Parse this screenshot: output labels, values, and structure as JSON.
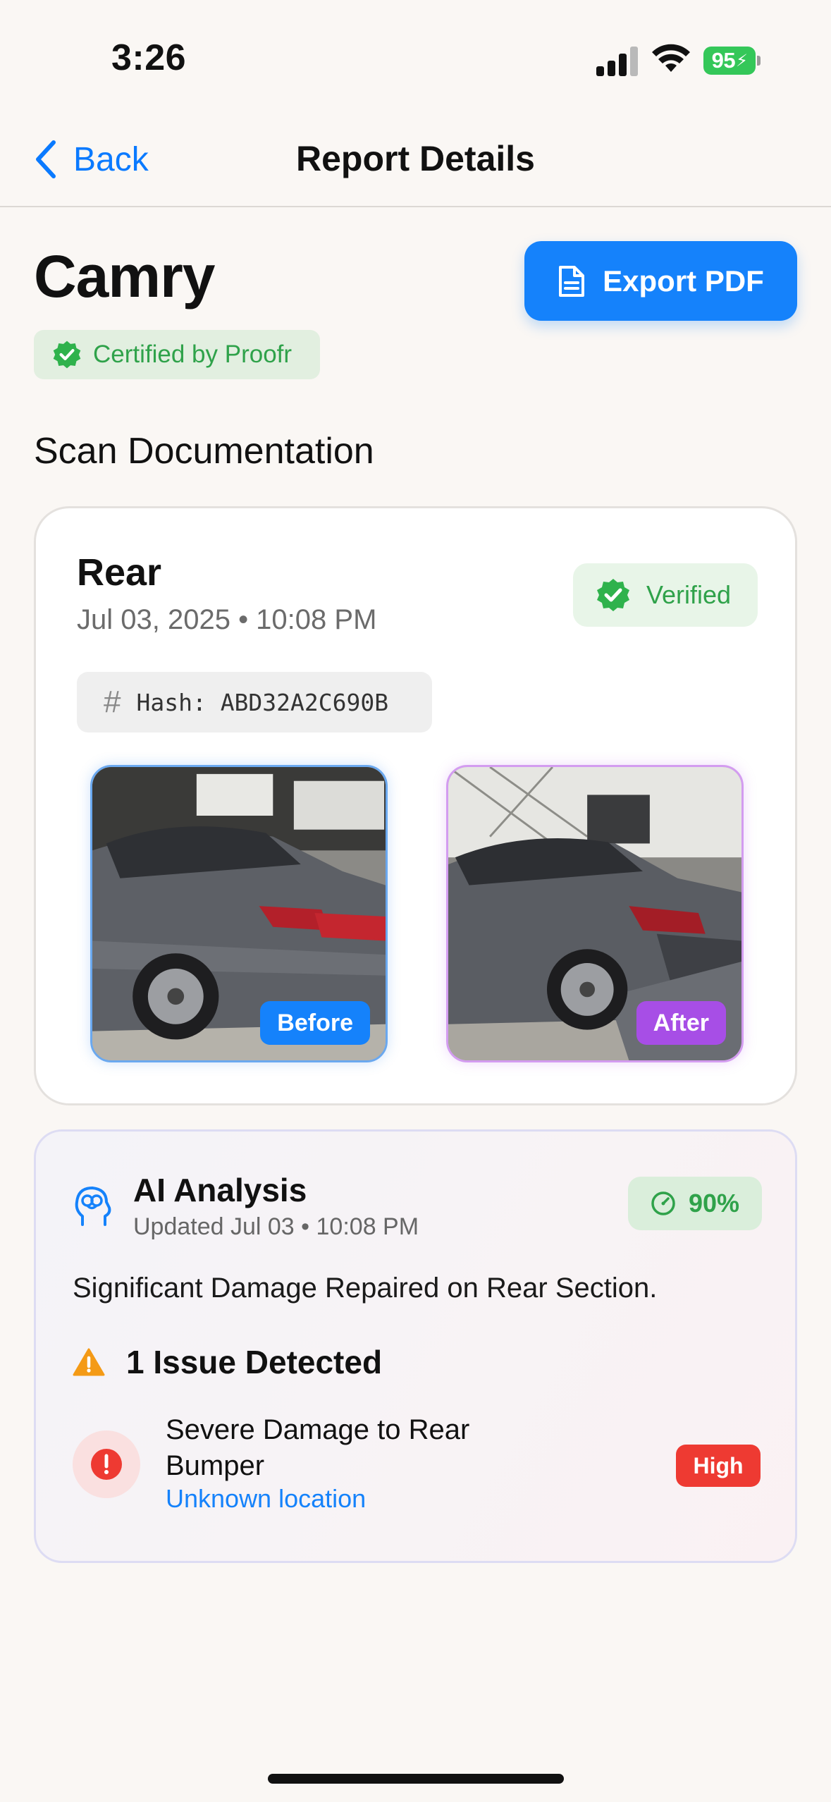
{
  "status_bar": {
    "time": "3:26",
    "battery": "95"
  },
  "nav": {
    "back_label": "Back",
    "title": "Report Details"
  },
  "header": {
    "title": "Camry",
    "export_label": "Export PDF",
    "certified_label": "Certified by Proofr"
  },
  "section_title": "Scan Documentation",
  "scan": {
    "title": "Rear",
    "date": "Jul 03, 2025 • 10:08 PM",
    "verified_label": "Verified",
    "hash_label": "Hash: ABD32A2C690B",
    "before_label": "Before",
    "after_label": "After"
  },
  "ai": {
    "title": "AI Analysis",
    "updated": "Updated Jul 03 • 10:08 PM",
    "score": "90%",
    "summary": "Significant Damage Repaired on Rear Section.",
    "issues_heading": "1 Issue Detected",
    "issues": [
      {
        "title": "Severe Damage to Rear Bumper",
        "location": "Unknown location",
        "severity": "High"
      }
    ]
  },
  "colors": {
    "accent": "#1582fb",
    "success": "#2fa24a",
    "danger": "#ee3a32",
    "after_accent": "#a74ee6"
  }
}
